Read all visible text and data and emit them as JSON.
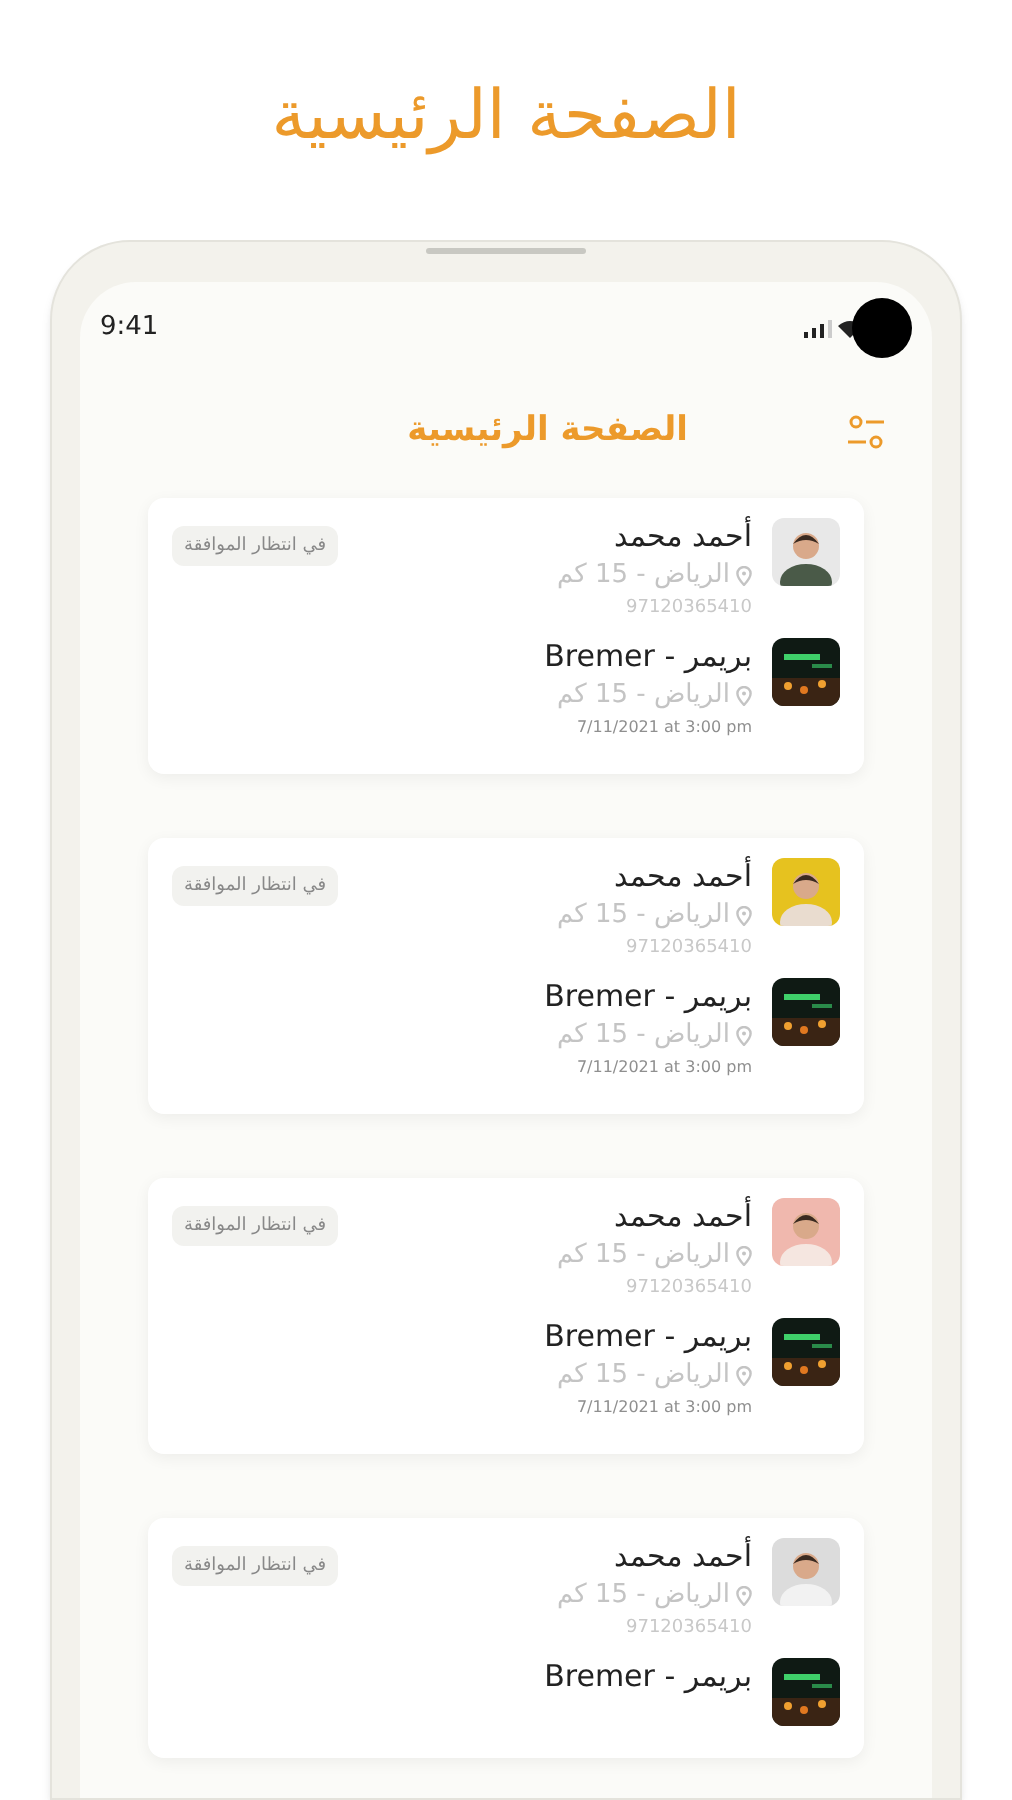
{
  "page_title": "الصفحة الرئيسية",
  "status_bar": {
    "time": "9:41"
  },
  "header": {
    "title": "الصفحة الرئيسية"
  },
  "requests": [
    {
      "status": "في انتظار الموافقة",
      "customer": {
        "name": "أحمد محمد",
        "location": "الرياض - 15 كم",
        "phone": "97120365410"
      },
      "restaurant": {
        "name": "بريمر - Bremer",
        "location": "الرياض - 15 كم",
        "date": "7/11/2021 at 3:00 pm"
      }
    },
    {
      "status": "في انتظار الموافقة",
      "customer": {
        "name": "أحمد محمد",
        "location": "الرياض - 15 كم",
        "phone": "97120365410"
      },
      "restaurant": {
        "name": "بريمر - Bremer",
        "location": "الرياض - 15 كم",
        "date": "7/11/2021 at 3:00 pm"
      }
    },
    {
      "status": "في انتظار الموافقة",
      "customer": {
        "name": "أحمد محمد",
        "location": "الرياض - 15 كم",
        "phone": "97120365410"
      },
      "restaurant": {
        "name": "بريمر - Bremer",
        "location": "الرياض - 15 كم",
        "date": "7/11/2021 at 3:00 pm"
      }
    },
    {
      "status": "في انتظار الموافقة",
      "customer": {
        "name": "أحمد محمد",
        "location": "الرياض - 15 كم",
        "phone": "97120365410"
      },
      "restaurant": {
        "name": "بريمر - Bremer"
      }
    }
  ]
}
